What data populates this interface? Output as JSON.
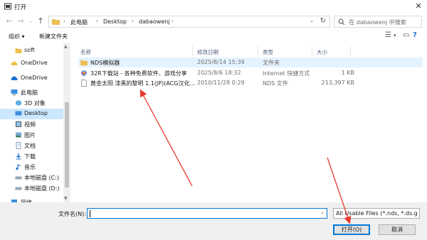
{
  "window": {
    "title": "打开"
  },
  "address_bar": {
    "crumbs": [
      "此电脑",
      "Desktop",
      "dabaowenj"
    ]
  },
  "search": {
    "placeholder": "在 dabaowenj 中搜索"
  },
  "toolbar": {
    "organize_label": "组织 ▾",
    "new_folder_label": "新建文件夹"
  },
  "nav_pane": {
    "items": [
      {
        "label": "soft",
        "icon": "folder-icon"
      },
      {
        "label": "OneDrive",
        "icon": "onedrive-icon"
      },
      {
        "label": "OneDrive",
        "icon": "onedrive-icon"
      },
      {
        "label": "此电脑",
        "icon": "pc-icon"
      },
      {
        "label": "3D 对象",
        "icon": "3d-objects-icon"
      },
      {
        "label": "Desktop",
        "icon": "desktop-icon"
      },
      {
        "label": "视频",
        "icon": "video-icon"
      },
      {
        "label": "图片",
        "icon": "pictures-icon"
      },
      {
        "label": "文档",
        "icon": "documents-icon"
      },
      {
        "label": "下载",
        "icon": "downloads-icon"
      },
      {
        "label": "音乐",
        "icon": "music-icon"
      },
      {
        "label": "本地磁盘 (C:)",
        "icon": "drive-icon"
      },
      {
        "label": "本地磁盘 (D:)",
        "icon": "drive-icon"
      },
      {
        "label": "网络",
        "icon": "network-icon"
      }
    ]
  },
  "file_list": {
    "columns": {
      "name": "名称",
      "date": "修改日期",
      "type": "类型",
      "size": "大小"
    },
    "rows": [
      {
        "name": "NDS模拟器",
        "date": "2025/8/14 15:39",
        "type": "文件夹",
        "size": "",
        "icon": "folder-icon"
      },
      {
        "name": "32R下载站 - 各种免费软件、游戏分享",
        "date": "2025/8/6 18:32",
        "type": "Internet 快捷方式",
        "size": "1 KB",
        "icon": "internet-shortcut-icon"
      },
      {
        "name": "黄金太阳 漆黑的黎明 1.1(JP)(ACG汉化...",
        "date": "2010/11/28 0:29",
        "type": "NDS 文件",
        "size": "213,397 KB",
        "icon": "file-icon"
      }
    ]
  },
  "bottom_bar": {
    "filename_label": "文件名(N):",
    "filename_value": "",
    "filter_value": "All Usable Files (*.nds, *.ds.g",
    "open_label": "打开(O)",
    "cancel_label": "取消"
  },
  "colors": {
    "accent": "#0078d7",
    "selected": "#cce8ff",
    "annotation_arrow": "#e8382c",
    "folder": "#f0c04e"
  }
}
